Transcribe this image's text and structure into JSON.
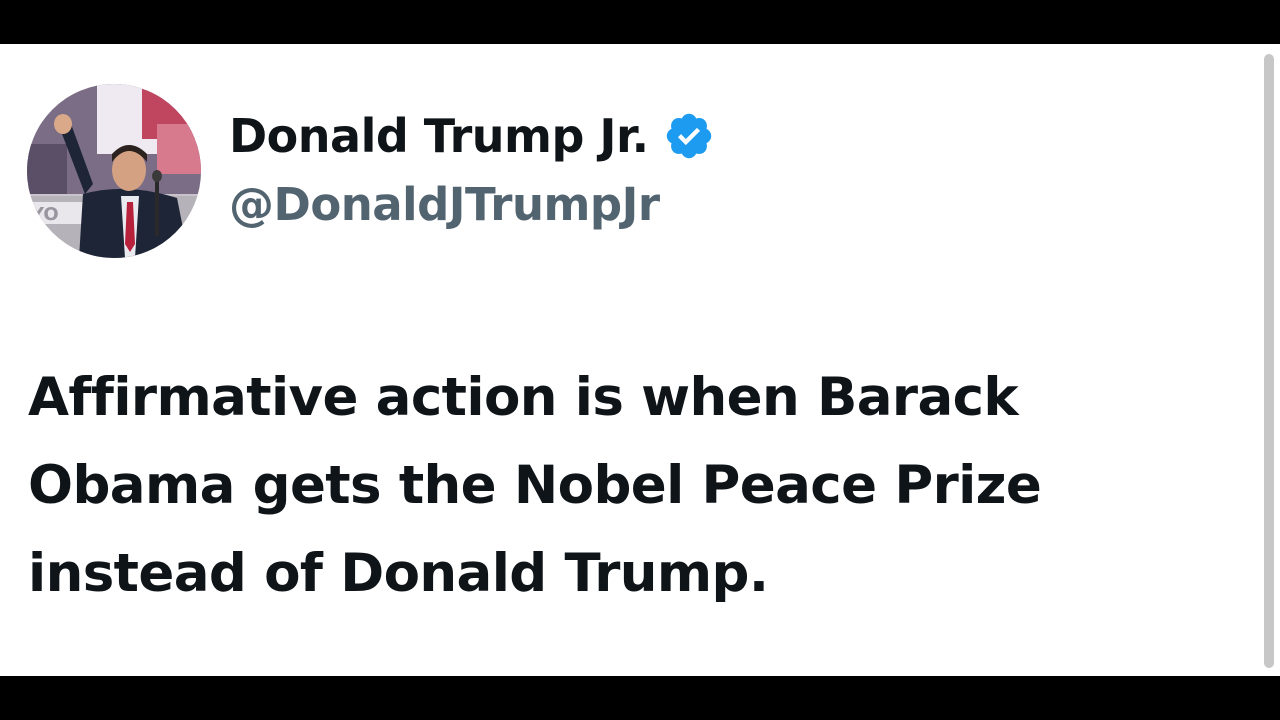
{
  "tweet": {
    "author": {
      "display_name": "Donald Trump Jr.",
      "handle": "@DonaldJTrumpJr",
      "verified": true,
      "avatar_icon": "profile-photo"
    },
    "text": "Affirmative action is when Barack Obama gets the Nobel Peace Prize instead of Donald Trump."
  },
  "colors": {
    "letterbox": "#000000",
    "card_background": "#ffffff",
    "name_text": "#0f1419",
    "handle_text": "#536471",
    "verified_badge": "#1d9bf0"
  },
  "icons": {
    "verified": "verified-badge-icon"
  }
}
